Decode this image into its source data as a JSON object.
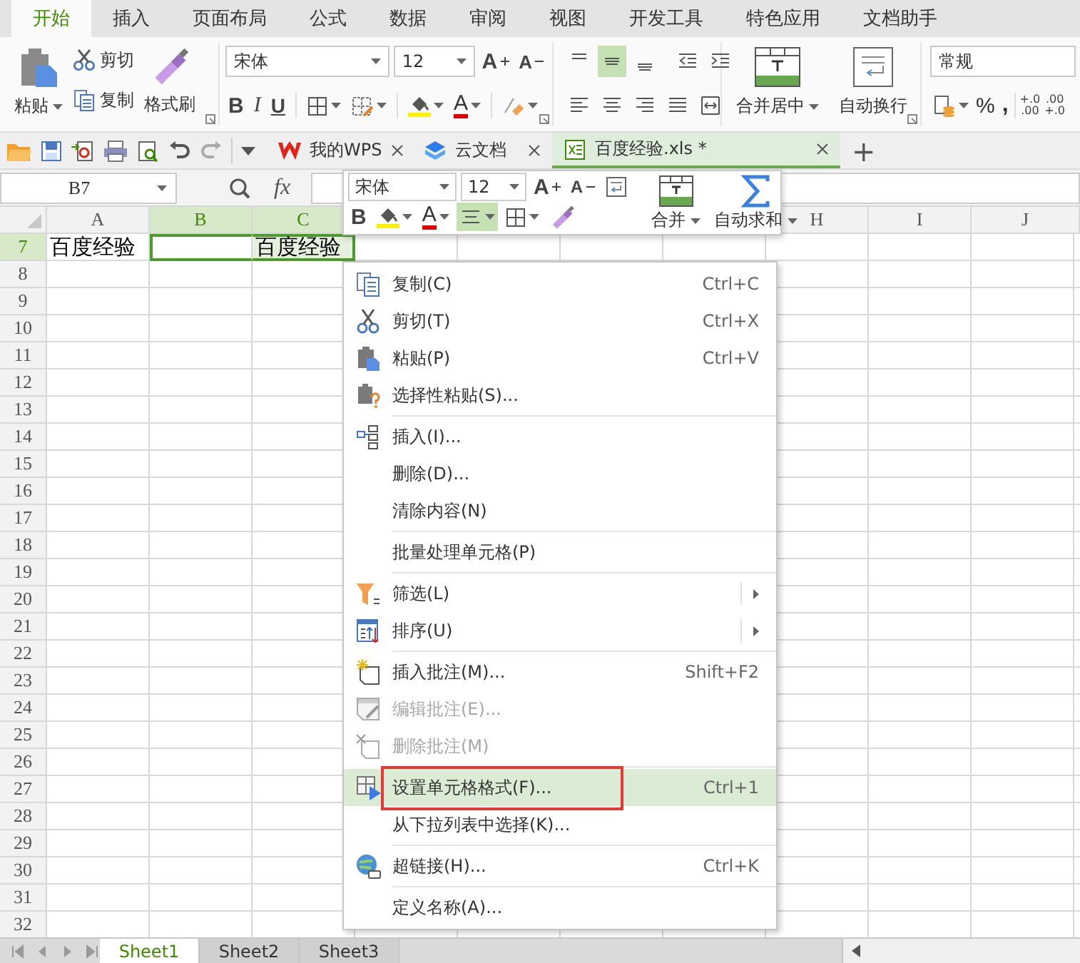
{
  "menu_tabs": [
    {
      "label": "开始",
      "selected": true
    },
    {
      "label": "插入",
      "selected": false
    },
    {
      "label": "页面布局",
      "selected": false
    },
    {
      "label": "公式",
      "selected": false
    },
    {
      "label": "数据",
      "selected": false
    },
    {
      "label": "审阅",
      "selected": false
    },
    {
      "label": "视图",
      "selected": false
    },
    {
      "label": "开发工具",
      "selected": false
    },
    {
      "label": "特色应用",
      "selected": false
    },
    {
      "label": "文档助手",
      "selected": false
    }
  ],
  "ribbon": {
    "paste": "粘贴",
    "cut": "剪切",
    "copy": "复制",
    "format_painter": "格式刷",
    "font": "宋体",
    "font_size": "12",
    "grow_font": "A",
    "shrink_font": "A",
    "bold": "B",
    "italic": "I",
    "underline": "U",
    "font_color": "A",
    "vertical_align": [
      {
        "selected": false
      },
      {
        "selected": true
      },
      {
        "selected": false
      }
    ],
    "merge_center": "合并居中",
    "wrap_text": "自动换行",
    "number_format": "常规",
    "percent": "%",
    "thousands": ",",
    "decimals": [
      {
        "top": "+.0",
        "bottom": ".00"
      },
      {
        "top": ".00",
        "bottom": "+.0"
      }
    ]
  },
  "document_tabs": [
    {
      "label": "我的WPS",
      "selected": false
    },
    {
      "label": "云文档",
      "selected": false
    },
    {
      "label": "百度经验.xls *",
      "selected": true
    }
  ],
  "new_tab": "+",
  "formula_bar": {
    "name_box": "B7",
    "fx": "fx"
  },
  "columns": [
    {
      "label": "A",
      "selected": false
    },
    {
      "label": "B",
      "selected": true
    },
    {
      "label": "C",
      "selected": true
    },
    {
      "label": "H",
      "selected": false
    },
    {
      "label": "I",
      "selected": false
    },
    {
      "label": "J",
      "selected": false
    }
  ],
  "rows": [
    {
      "number": "7",
      "selected": true,
      "cells": [
        {
          "text": "百度经验",
          "selected": false,
          "active": false
        },
        {
          "text": null,
          "selected": true,
          "active": true
        },
        {
          "text": "百度经验",
          "selected": true,
          "active": false
        }
      ]
    },
    {
      "number": "8",
      "selected": false
    },
    {
      "number": "9",
      "selected": false
    },
    {
      "number": "10",
      "selected": false
    },
    {
      "number": "11",
      "selected": false
    },
    {
      "number": "12",
      "selected": false
    },
    {
      "number": "13",
      "selected": false
    },
    {
      "number": "14",
      "selected": false
    },
    {
      "number": "15",
      "selected": false
    },
    {
      "number": "16",
      "selected": false
    },
    {
      "number": "17",
      "selected": false
    },
    {
      "number": "18",
      "selected": false
    },
    {
      "number": "19",
      "selected": false
    },
    {
      "number": "20",
      "selected": false
    },
    {
      "number": "21",
      "selected": false
    },
    {
      "number": "22",
      "selected": false
    },
    {
      "number": "23",
      "selected": false
    },
    {
      "number": "24",
      "selected": false
    },
    {
      "number": "25",
      "selected": false
    },
    {
      "number": "26",
      "selected": false
    },
    {
      "number": "27",
      "selected": false
    },
    {
      "number": "28",
      "selected": false
    },
    {
      "number": "29",
      "selected": false
    },
    {
      "number": "30",
      "selected": false
    },
    {
      "number": "31",
      "selected": false
    },
    {
      "number": "32",
      "selected": false
    }
  ],
  "sheet_tabs": [
    {
      "label": "Sheet1",
      "selected": true
    },
    {
      "label": "Sheet2",
      "selected": false
    },
    {
      "label": "Sheet3",
      "selected": false
    }
  ],
  "mini_toolbar": {
    "font": "宋体",
    "font_size": "12",
    "grow_font": "A",
    "shrink_font": "A",
    "bold": "B",
    "font_color": "A",
    "align_center": {
      "selected": true
    },
    "merge": "合并",
    "autosum": "自动求和"
  },
  "context_menu": [
    [
      {
        "kind": "copy",
        "label": "复制(C)",
        "shortcut": "Ctrl+C",
        "submenu": false,
        "disabled": false,
        "selected": false,
        "outlined": false
      },
      {
        "kind": "cut",
        "label": "剪切(T)",
        "shortcut": "Ctrl+X",
        "submenu": false,
        "disabled": false,
        "selected": false,
        "outlined": false
      },
      {
        "kind": "paste",
        "label": "粘贴(P)",
        "shortcut": "Ctrl+V",
        "submenu": false,
        "disabled": false,
        "selected": false,
        "outlined": false
      },
      {
        "kind": "paste-special",
        "label": "选择性粘贴(S)...",
        "submenu": false,
        "disabled": false,
        "selected": false,
        "outlined": false
      }
    ],
    [
      {
        "kind": "insert",
        "label": "插入(I)...",
        "submenu": false,
        "disabled": false,
        "selected": false,
        "outlined": false
      },
      {
        "kind": "plain",
        "label": "删除(D)...",
        "submenu": false,
        "disabled": false,
        "selected": false,
        "outlined": false
      },
      {
        "kind": "plain",
        "label": "清除内容(N)",
        "submenu": false,
        "disabled": false,
        "selected": false,
        "outlined": false
      }
    ],
    [
      {
        "kind": "plain",
        "label": "批量处理单元格(P)",
        "submenu": false,
        "disabled": false,
        "selected": false,
        "outlined": false
      }
    ],
    [
      {
        "kind": "filter",
        "label": "筛选(L)",
        "submenu": true,
        "disabled": false,
        "selected": false,
        "outlined": false
      },
      {
        "kind": "sort",
        "label": "排序(U)",
        "submenu": true,
        "disabled": false,
        "selected": false,
        "outlined": false
      }
    ],
    [
      {
        "kind": "comment-new",
        "label": "插入批注(M)...",
        "shortcut": "Shift+F2",
        "submenu": false,
        "disabled": false,
        "selected": false,
        "outlined": false
      },
      {
        "kind": "comment-edit",
        "label": "编辑批注(E)...",
        "submenu": false,
        "disabled": true,
        "selected": false,
        "outlined": false
      },
      {
        "kind": "comment-delete",
        "label": "删除批注(M)",
        "submenu": false,
        "disabled": true,
        "selected": false,
        "outlined": false
      }
    ],
    [
      {
        "kind": "format-cells",
        "label": "设置单元格格式(F)...",
        "shortcut": "Ctrl+1",
        "submenu": false,
        "disabled": false,
        "selected": true,
        "outlined": true
      },
      {
        "kind": "plain",
        "label": "从下拉列表中选择(K)...",
        "submenu": false,
        "disabled": false,
        "selected": false,
        "outlined": false
      }
    ],
    [
      {
        "kind": "hyperlink",
        "label": "超链接(H)...",
        "shortcut": "Ctrl+K",
        "submenu": false,
        "disabled": false,
        "selected": false,
        "outlined": false
      }
    ],
    [
      {
        "kind": "plain",
        "label": "定义名称(A)...",
        "submenu": false,
        "disabled": false,
        "selected": false,
        "outlined": false
      }
    ]
  ]
}
